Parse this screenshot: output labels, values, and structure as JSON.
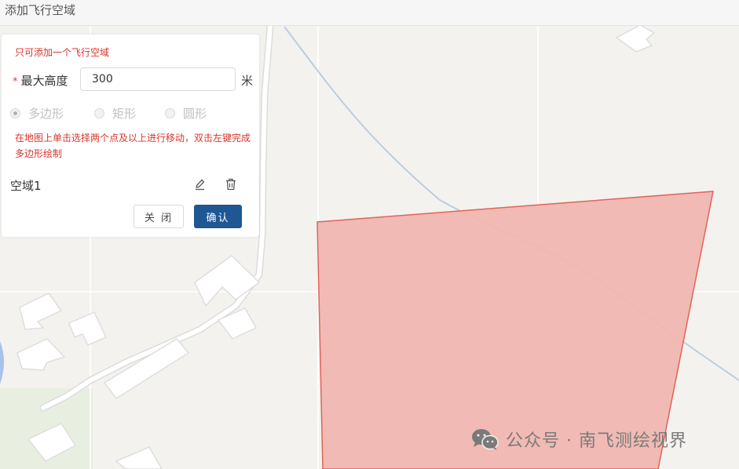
{
  "window": {
    "title": "添加飞行空域"
  },
  "panel": {
    "notice": "只可添加一个飞行空域",
    "altitude": {
      "required_mark": "*",
      "label": "最大高度",
      "value": "300",
      "unit": "米"
    },
    "shape_options": [
      {
        "label": "多边形",
        "checked": true
      },
      {
        "label": "矩形",
        "checked": false
      },
      {
        "label": "圆形",
        "checked": false
      }
    ],
    "hint": "在地图上单击选择两个点及以上进行移动，双击左键完成多边形绘制",
    "airspace": {
      "name": "空域1"
    },
    "buttons": {
      "close": "关 闭",
      "confirm": "确认"
    }
  },
  "map": {
    "polygon_fill": "#f0b6b0",
    "polygon_stroke": "#e0645a"
  },
  "watermark": {
    "text": "公众号 · 南飞测绘视界"
  }
}
